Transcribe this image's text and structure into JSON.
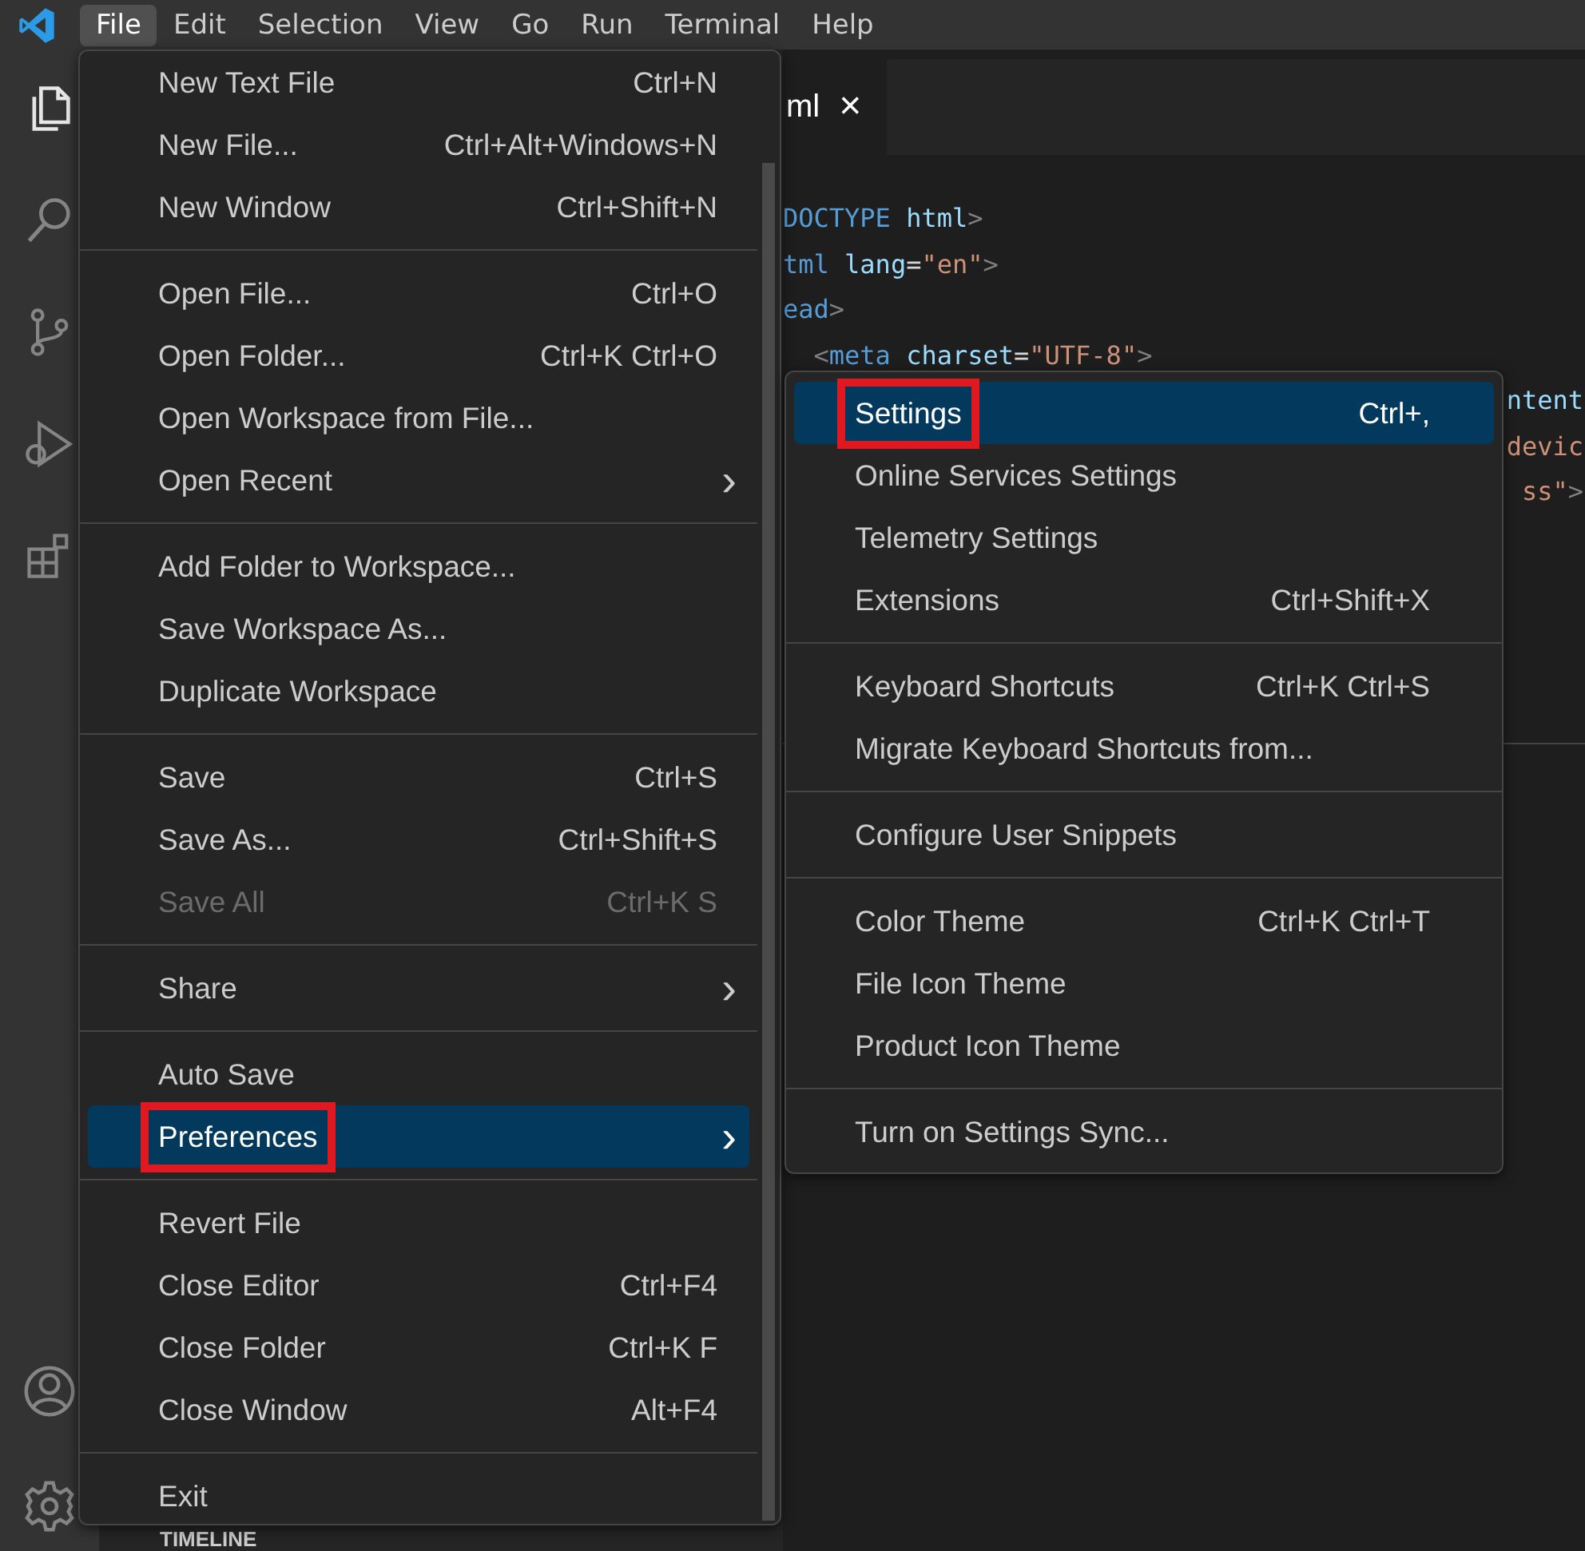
{
  "menubar": [
    {
      "label": "File",
      "selected": true
    },
    {
      "label": "Edit",
      "selected": false
    },
    {
      "label": "Selection",
      "selected": false
    },
    {
      "label": "View",
      "selected": false
    },
    {
      "label": "Go",
      "selected": false
    },
    {
      "label": "Run",
      "selected": false
    },
    {
      "label": "Terminal",
      "selected": false
    },
    {
      "label": "Help",
      "selected": false
    }
  ],
  "editor_tab": {
    "label": "ml",
    "close": "×"
  },
  "code_lines": [
    {
      "kind": "left",
      "tokens": [
        {
          "t": "DOCTYPE",
          "kind": "tag"
        },
        {
          "t": " html",
          "kind": "attr"
        },
        {
          "t": ">",
          "kind": "punct"
        }
      ]
    },
    {
      "kind": "left",
      "tokens": [
        {
          "t": "tml",
          "kind": "tag"
        },
        {
          "t": " lang",
          "kind": "attr"
        },
        {
          "t": "=",
          "kind": "plain"
        },
        {
          "t": "\"en\"",
          "kind": "string"
        },
        {
          "t": ">",
          "kind": "punct"
        }
      ]
    },
    {
      "kind": "left",
      "tokens": [
        {
          "t": "ead",
          "kind": "tag"
        },
        {
          "t": ">",
          "kind": "punct"
        }
      ]
    },
    {
      "kind": "left",
      "tokens": [
        {
          "t": "  <",
          "kind": "punct"
        },
        {
          "t": "meta",
          "kind": "tag"
        },
        {
          "t": " charset",
          "kind": "attr"
        },
        {
          "t": "=",
          "kind": "plain"
        },
        {
          "t": "\"UTF-8\"",
          "kind": "string"
        },
        {
          "t": ">",
          "kind": "punct"
        }
      ]
    },
    {
      "kind": "right",
      "tokens": [
        {
          "t": "ntent",
          "kind": "attr"
        }
      ]
    },
    {
      "kind": "right",
      "tokens": [
        {
          "t": "devic",
          "kind": "string"
        }
      ]
    },
    {
      "kind": "right",
      "tokens": [
        {
          "t": "ss\"",
          "kind": "string"
        },
        {
          "t": ">",
          "kind": "punct"
        }
      ]
    }
  ],
  "sidebar": {
    "section": "TIMELINE"
  },
  "file_menu": [
    {
      "kind": "item",
      "label": "New Text File",
      "shortcut": "Ctrl+N",
      "selected": false
    },
    {
      "kind": "item",
      "label": "New File...",
      "shortcut": "Ctrl+Alt+Windows+N",
      "selected": false
    },
    {
      "kind": "item",
      "label": "New Window",
      "shortcut": "Ctrl+Shift+N",
      "selected": false
    },
    {
      "kind": "separator"
    },
    {
      "kind": "item",
      "label": "Open File...",
      "shortcut": "Ctrl+O",
      "selected": false
    },
    {
      "kind": "item",
      "label": "Open Folder...",
      "shortcut": "Ctrl+K Ctrl+O",
      "selected": false
    },
    {
      "kind": "item",
      "label": "Open Workspace from File...",
      "selected": false
    },
    {
      "kind": "submenu",
      "label": "Open Recent",
      "arrow": "›",
      "selected": false
    },
    {
      "kind": "separator"
    },
    {
      "kind": "item",
      "label": "Add Folder to Workspace...",
      "selected": false
    },
    {
      "kind": "item",
      "label": "Save Workspace As...",
      "selected": false
    },
    {
      "kind": "item",
      "label": "Duplicate Workspace",
      "selected": false
    },
    {
      "kind": "separator"
    },
    {
      "kind": "item",
      "label": "Save",
      "shortcut": "Ctrl+S",
      "selected": false
    },
    {
      "kind": "item",
      "label": "Save As...",
      "shortcut": "Ctrl+Shift+S",
      "selected": false
    },
    {
      "kind": "item",
      "label": "Save All",
      "shortcut": "Ctrl+K S",
      "disabled": true,
      "selected": false
    },
    {
      "kind": "separator"
    },
    {
      "kind": "submenu",
      "label": "Share",
      "arrow": "›",
      "selected": false
    },
    {
      "kind": "separator"
    },
    {
      "kind": "item",
      "label": "Auto Save",
      "selected": false
    },
    {
      "kind": "submenu",
      "label": "Preferences",
      "arrow": "›",
      "selected": true,
      "highlighted": true
    },
    {
      "kind": "separator"
    },
    {
      "kind": "item",
      "label": "Revert File",
      "selected": false
    },
    {
      "kind": "item",
      "label": "Close Editor",
      "shortcut": "Ctrl+F4",
      "selected": false
    },
    {
      "kind": "item",
      "label": "Close Folder",
      "shortcut": "Ctrl+K F",
      "selected": false
    },
    {
      "kind": "item",
      "label": "Close Window",
      "shortcut": "Alt+F4",
      "selected": false
    },
    {
      "kind": "separator"
    },
    {
      "kind": "item",
      "label": "Exit",
      "selected": false
    }
  ],
  "preferences_menu": [
    {
      "kind": "item",
      "label": "Settings",
      "shortcut": "Ctrl+,",
      "selected": true,
      "highlighted": true
    },
    {
      "kind": "item",
      "label": "Online Services Settings",
      "selected": false
    },
    {
      "kind": "item",
      "label": "Telemetry Settings",
      "selected": false
    },
    {
      "kind": "item",
      "label": "Extensions",
      "shortcut": "Ctrl+Shift+X",
      "selected": false
    },
    {
      "kind": "separator"
    },
    {
      "kind": "item",
      "label": "Keyboard Shortcuts",
      "shortcut": "Ctrl+K Ctrl+S",
      "selected": false
    },
    {
      "kind": "item",
      "label": "Migrate Keyboard Shortcuts from...",
      "selected": false
    },
    {
      "kind": "separator"
    },
    {
      "kind": "item",
      "label": "Configure User Snippets",
      "selected": false
    },
    {
      "kind": "separator"
    },
    {
      "kind": "item",
      "label": "Color Theme",
      "shortcut": "Ctrl+K Ctrl+T",
      "selected": false
    },
    {
      "kind": "item",
      "label": "File Icon Theme",
      "selected": false
    },
    {
      "kind": "item",
      "label": "Product Icon Theme",
      "selected": false
    },
    {
      "kind": "separator"
    },
    {
      "kind": "item",
      "label": "Turn on Settings Sync...",
      "selected": false
    }
  ]
}
